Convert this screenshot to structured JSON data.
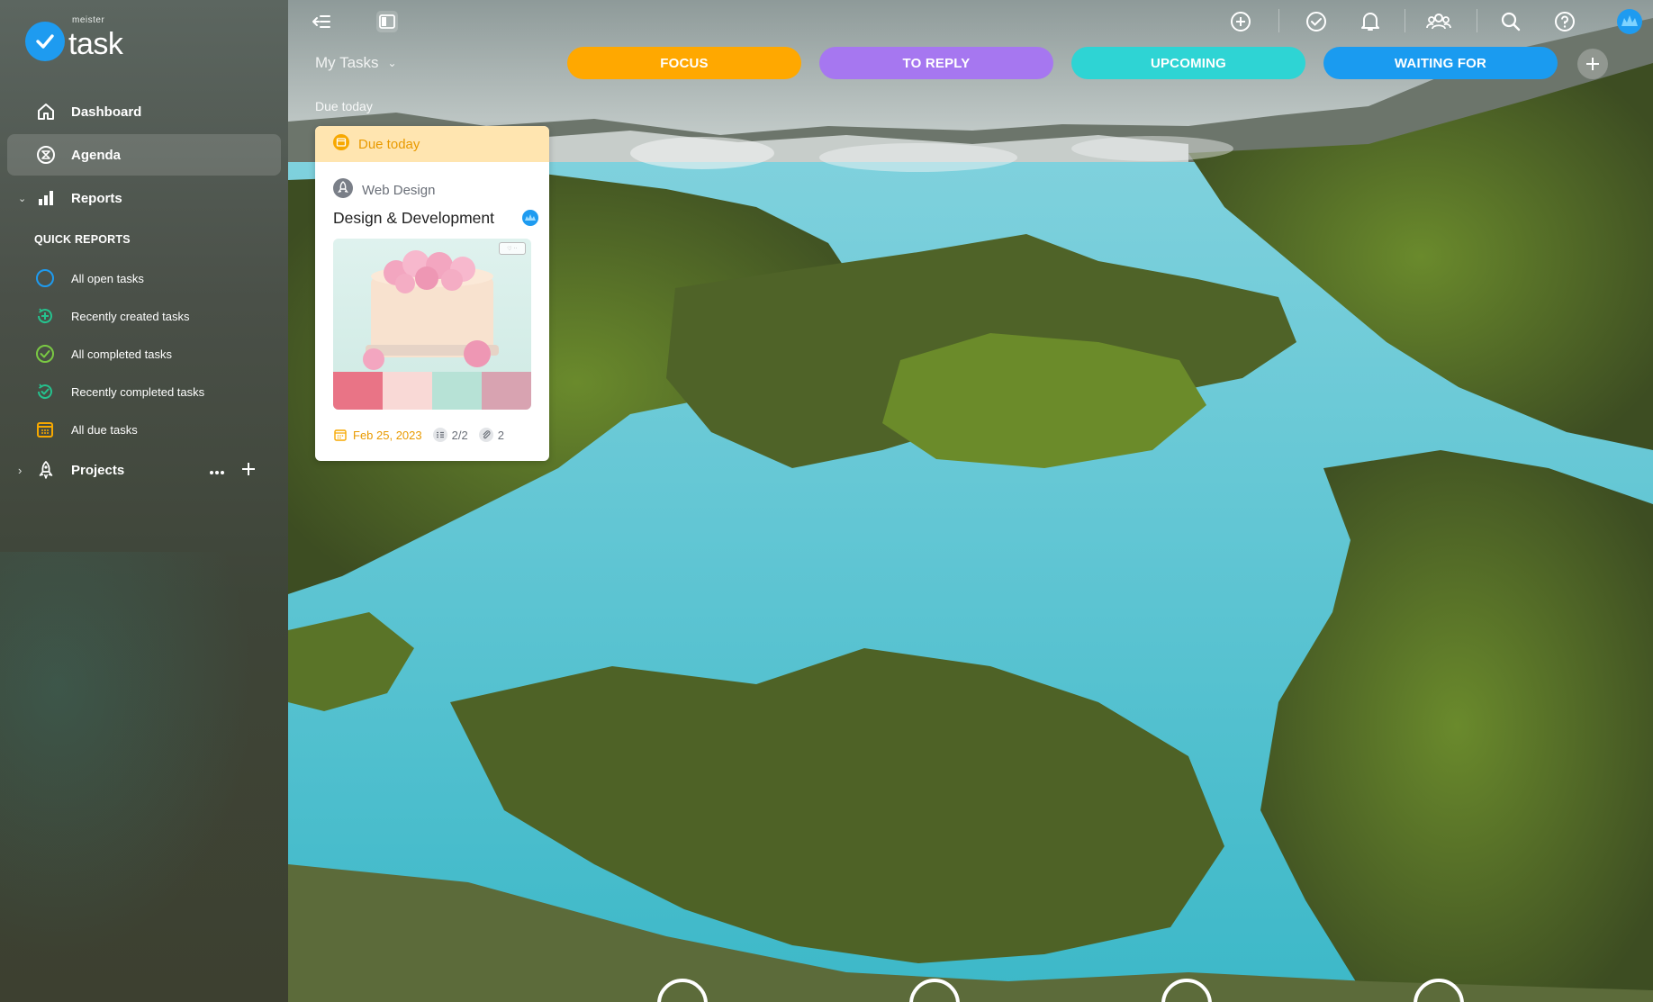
{
  "app": {
    "logo_small": "meister",
    "logo_text": "task"
  },
  "sidebar": {
    "items": [
      {
        "label": "Dashboard",
        "icon": "home-icon"
      },
      {
        "label": "Agenda",
        "icon": "agenda-icon",
        "active": true
      },
      {
        "label": "Reports",
        "icon": "bar-chart-icon"
      }
    ],
    "quick_reports_heading": "QUICK REPORTS",
    "quick_reports": [
      {
        "label": "All open tasks",
        "icon": "open-circle-icon",
        "color": "#1e9bf0"
      },
      {
        "label": "Recently created tasks",
        "icon": "recent-created-icon",
        "color": "#25c28e"
      },
      {
        "label": "All completed tasks",
        "icon": "check-circle-icon",
        "color": "#7ac943"
      },
      {
        "label": "Recently completed tasks",
        "icon": "recent-completed-icon",
        "color": "#25c28e"
      },
      {
        "label": "All due tasks",
        "icon": "calendar-icon",
        "color": "#f7a800"
      }
    ],
    "projects_label": "Projects"
  },
  "topbar": {
    "view_title": "My Tasks",
    "filters": [
      {
        "label": "FOCUS",
        "color": "#ffa800"
      },
      {
        "label": "TO REPLY",
        "color": "#a677f0"
      },
      {
        "label": "UPCOMING",
        "color": "#2ed4d4"
      },
      {
        "label": "WAITING FOR",
        "color": "#1a9bf0"
      }
    ]
  },
  "section": {
    "label": "Due today"
  },
  "card": {
    "header": "Due today",
    "project": "Web Design",
    "title": "Design & Development",
    "date": "Feb 25, 2023",
    "checklist": "2/2",
    "attachments": "2",
    "swatches": [
      "#e97486",
      "#f9d9d6",
      "#b7e2d6",
      "#d8a3b1"
    ]
  }
}
